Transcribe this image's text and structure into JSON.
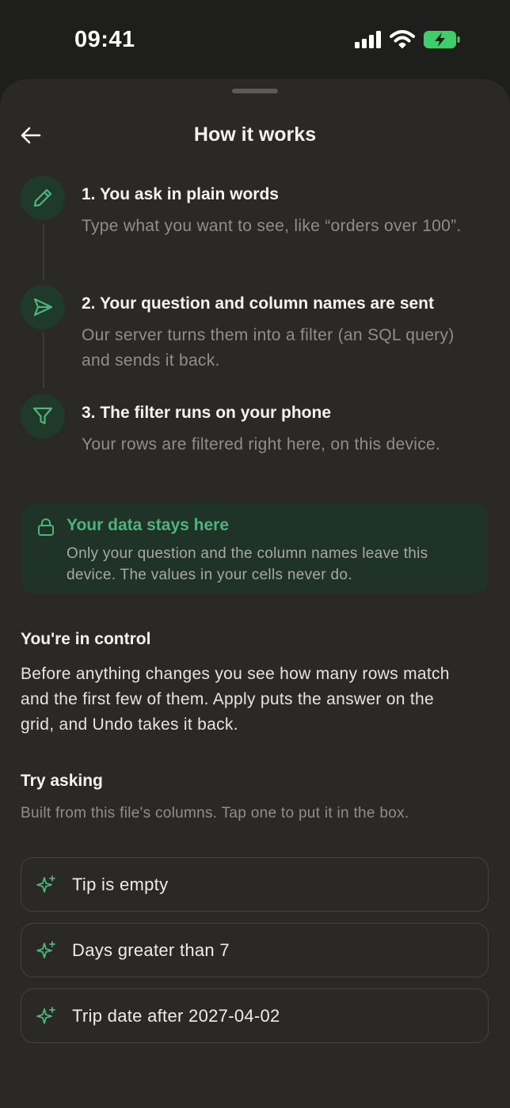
{
  "status_bar": {
    "time": "09:41",
    "icons": [
      "cellular-signal-icon",
      "wifi-icon",
      "battery-charging-icon"
    ],
    "battery_color": "#3ecf6a"
  },
  "header": {
    "back_icon": "arrow-left-icon",
    "title": "How it works"
  },
  "steps": [
    {
      "icon": "pencil-icon",
      "title": "1. You ask in plain words",
      "description": "Type what you want to see, like “orders over 100”."
    },
    {
      "icon": "send-icon",
      "title": "2. Your question and column names are sent",
      "description": "Our server turns them into a filter (an SQL query) and sends it back."
    },
    {
      "icon": "filter-icon",
      "title": "3. The filter runs on your phone",
      "description": "Your rows are filtered right here, on this device."
    }
  ],
  "privacy": {
    "icon": "lock-icon",
    "title": "Your data stays here",
    "description": "Only your question and the column names leave this device. The values in your cells never do."
  },
  "control": {
    "heading": "You're in control",
    "body": "Before anything changes you see how many rows match and the first few of them. Apply puts the answer on the grid, and Undo takes it back."
  },
  "try_asking": {
    "heading": "Try asking",
    "subtitle": "Built from this file's columns. Tap one to put it in the box.",
    "suggestion_icon": "sparkle-icon",
    "suggestions": [
      "Tip is empty",
      "Days greater than 7",
      "Trip date after 2027-04-02"
    ]
  },
  "colors": {
    "accent": "#4fb37a",
    "background": "#1e1e1c",
    "sheet": "#2a2926",
    "icon_circle": "#1f3a2b"
  }
}
